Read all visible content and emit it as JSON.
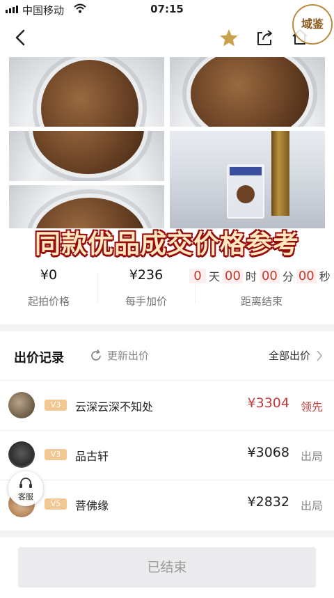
{
  "status_bar": {
    "carrier": "中国移动",
    "time": "07:15"
  },
  "nav": {
    "back_icon": "chevron-left-icon",
    "favorite_icon": "star-icon",
    "share_icon": "share-icon",
    "home_icon": "home-icon",
    "accent": "#c8a24c"
  },
  "watermark": {
    "text": "域鉴"
  },
  "gallery": {
    "overlay_text": "同款优品成交价格参考"
  },
  "prices": {
    "start": {
      "value": "¥0",
      "label": "起拍价格"
    },
    "increment": {
      "value": "¥236",
      "label": "每手加价"
    },
    "countdown": {
      "label": "距离结束",
      "days": "0",
      "days_unit": "天",
      "hours": "00",
      "hours_unit": "时",
      "minutes": "00",
      "minutes_unit": "分",
      "seconds": "00",
      "seconds_unit": "秒"
    }
  },
  "bids": {
    "title": "出价记录",
    "refresh_label": "更新出价",
    "all_label": "全部出价",
    "rows": [
      {
        "vip": "V3",
        "name": "云深云深不知处",
        "price": "¥3304",
        "status": "领先",
        "leading": true
      },
      {
        "vip": "V3",
        "name": "品古轩",
        "price": "¥3068",
        "status": "出局",
        "leading": false
      },
      {
        "vip": "V5",
        "name": "菩佛缘",
        "price": "¥2832",
        "status": "出局",
        "leading": false
      }
    ]
  },
  "service": {
    "label": "客服"
  },
  "footer": {
    "ended_label": "已结束"
  },
  "colors": {
    "lead_red": "#c43a3a",
    "overlay_text": "#ffe7c0",
    "overlay_outline": "#9b0d0d",
    "vip_badge": "#f1c792"
  }
}
